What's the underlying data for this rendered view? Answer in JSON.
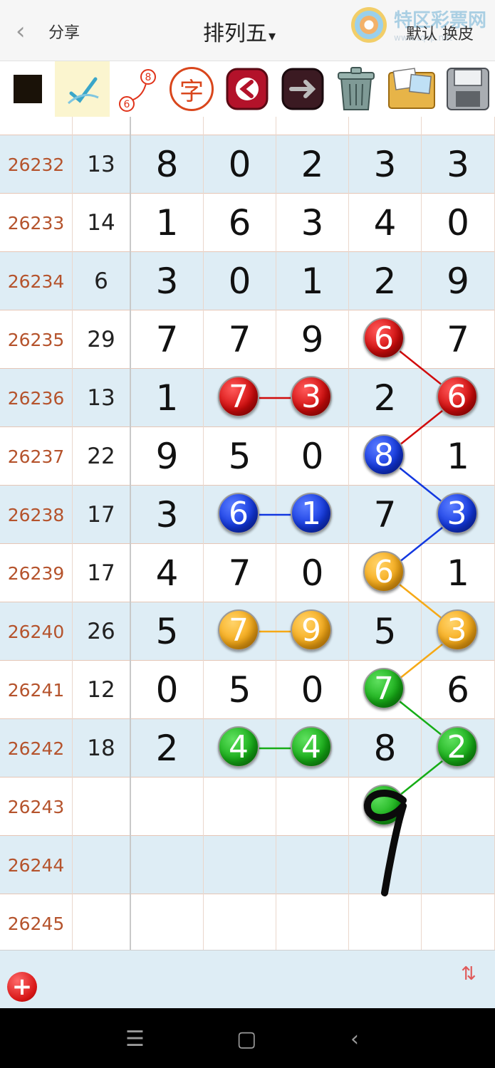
{
  "header": {
    "back_label": "‹",
    "share_label": "分享",
    "title": "排列五",
    "title_caret": "▾",
    "brand_name": "特区彩票网",
    "brand_sub": "www.tqcp.net",
    "skin_label": "默认 换皮"
  },
  "toolbar": {
    "icons": [
      "black-square-icon",
      "pen-check-icon",
      "link-6-8-icon",
      "char-zi-icon",
      "arrow-left-icon",
      "arrow-right-icon",
      "trash-icon",
      "photo-album-icon",
      "floppy-save-icon"
    ],
    "link_from": "6",
    "link_to": "8",
    "char_label": "字"
  },
  "table": {
    "rows": [
      {
        "issue": "26232",
        "sum": "13",
        "digits": [
          "8",
          "0",
          "2",
          "3",
          "3"
        ]
      },
      {
        "issue": "26233",
        "sum": "14",
        "digits": [
          "1",
          "6",
          "3",
          "4",
          "0"
        ]
      },
      {
        "issue": "26234",
        "sum": "6",
        "digits": [
          "3",
          "0",
          "1",
          "2",
          "9"
        ]
      },
      {
        "issue": "26235",
        "sum": "29",
        "digits": [
          "7",
          "7",
          "9",
          "6",
          "7"
        ]
      },
      {
        "issue": "26236",
        "sum": "13",
        "digits": [
          "1",
          "7",
          "3",
          "2",
          "6"
        ]
      },
      {
        "issue": "26237",
        "sum": "22",
        "digits": [
          "9",
          "5",
          "0",
          "8",
          "1"
        ]
      },
      {
        "issue": "26238",
        "sum": "17",
        "digits": [
          "3",
          "6",
          "1",
          "7",
          "3"
        ]
      },
      {
        "issue": "26239",
        "sum": "17",
        "digits": [
          "4",
          "7",
          "0",
          "6",
          "1"
        ]
      },
      {
        "issue": "26240",
        "sum": "26",
        "digits": [
          "5",
          "7",
          "9",
          "5",
          "3"
        ]
      },
      {
        "issue": "26241",
        "sum": "12",
        "digits": [
          "0",
          "5",
          "0",
          "7",
          "6"
        ]
      },
      {
        "issue": "26242",
        "sum": "18",
        "digits": [
          "2",
          "4",
          "4",
          "8",
          "2"
        ]
      },
      {
        "issue": "26243",
        "sum": "",
        "digits": [
          "",
          "",
          "",
          "",
          ""
        ]
      },
      {
        "issue": "26244",
        "sum": "",
        "digits": [
          "",
          "",
          "",
          "",
          ""
        ]
      },
      {
        "issue": "26245",
        "sum": "",
        "digits": [
          "",
          "",
          "",
          "",
          ""
        ]
      }
    ],
    "markers": [
      {
        "row": 3,
        "col": 3,
        "color": "red",
        "value": "6"
      },
      {
        "row": 4,
        "col": 1,
        "color": "red",
        "value": "7"
      },
      {
        "row": 4,
        "col": 2,
        "color": "red",
        "value": "3"
      },
      {
        "row": 4,
        "col": 4,
        "color": "red",
        "value": "6"
      },
      {
        "row": 5,
        "col": 3,
        "color": "blue",
        "value": "8"
      },
      {
        "row": 6,
        "col": 1,
        "color": "blue",
        "value": "6"
      },
      {
        "row": 6,
        "col": 2,
        "color": "blue",
        "value": "1"
      },
      {
        "row": 6,
        "col": 4,
        "color": "blue",
        "value": "3"
      },
      {
        "row": 7,
        "col": 3,
        "color": "orange",
        "value": "6"
      },
      {
        "row": 8,
        "col": 1,
        "color": "orange",
        "value": "7"
      },
      {
        "row": 8,
        "col": 2,
        "color": "orange",
        "value": "9"
      },
      {
        "row": 8,
        "col": 4,
        "color": "orange",
        "value": "3"
      },
      {
        "row": 9,
        "col": 3,
        "color": "green",
        "value": "7"
      },
      {
        "row": 10,
        "col": 1,
        "color": "green",
        "value": "4"
      },
      {
        "row": 10,
        "col": 2,
        "color": "green",
        "value": "4"
      },
      {
        "row": 10,
        "col": 4,
        "color": "green",
        "value": "2"
      },
      {
        "row": 11,
        "col": 3,
        "color": "green",
        "value": ""
      }
    ],
    "handwritten_prediction": "9"
  },
  "colors": {
    "red": "#d10b0b",
    "blue": "#1338e0",
    "orange": "#f6a916",
    "green": "#16ad16",
    "row_alt": "#deedf5",
    "issue_text": "#b5532c"
  },
  "bottom": {
    "add_label": "+",
    "updown_label": "⇅"
  },
  "system_nav": {
    "menu_label": "☰",
    "home_label": "▢",
    "back_label": "‹"
  }
}
